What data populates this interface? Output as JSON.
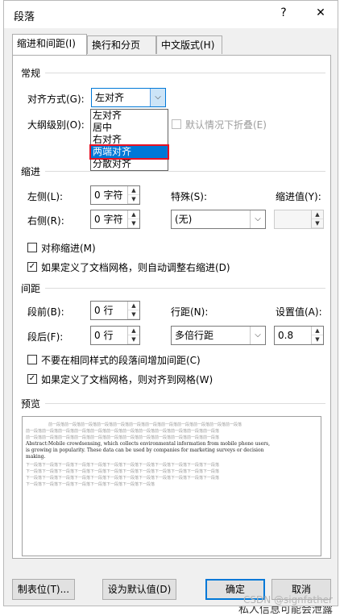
{
  "dialog": {
    "title": "段落",
    "help_button": "?",
    "close_button": "✕"
  },
  "tabs": [
    {
      "label": "缩进和间距(I)"
    },
    {
      "label": "换行和分页(P)"
    },
    {
      "label": "中文版式(H)"
    }
  ],
  "general": {
    "header": "常规",
    "alignment_label": "对齐方式(G):",
    "alignment_value": "左对齐",
    "alignment_options": [
      "左对齐",
      "居中",
      "右对齐",
      "两端对齐",
      "分散对齐"
    ],
    "outline_label": "大纲级别(O):",
    "collapse_label": "默认情况下折叠(E)"
  },
  "indent": {
    "header": "缩进",
    "left_label": "左侧(L):",
    "left_value": "0 字符",
    "right_label": "右侧(R):",
    "right_value": "0 字符",
    "special_label": "特殊(S):",
    "special_value": "(无)",
    "by_label": "缩进值(Y):",
    "mirror_label": "对称缩进(M)",
    "auto_adjust_label": "如果定义了文档网格，则自动调整右缩进(D)"
  },
  "spacing": {
    "header": "间距",
    "before_label": "段前(B):",
    "before_value": "0 行",
    "after_label": "段后(F):",
    "after_value": "0 行",
    "line_spacing_label": "行距(N):",
    "line_spacing_value": "多倍行距",
    "at_label": "设置值(A):",
    "at_value": "0.8",
    "no_space_label": "不要在相同样式的段落间增加间距(C)",
    "snap_grid_label": "如果定义了文档网格，则对齐到网格(W)"
  },
  "preview": {
    "header": "预览",
    "prev_line": "前一段落前一段落前一段落前一段落前一段落前一段落前一段落前一段落前一段落前一段落前一段落前一段落",
    "sample_line1": "Abstract:Mobile crowdsensing, which collects environmental information from mobile phone users,",
    "sample_line2": "is growing in popularity.  These data can be used by companies for marketing surveys or decision",
    "sample_line3": "making.",
    "next_line": "下一段落下一段落下一段落下一段落下一段落下一段落下一段落下一段落下一段落下一段落下一段落下一段落"
  },
  "buttons": {
    "tabs_button": "制表位(T)...",
    "default_button": "设为默认值(D)",
    "ok_button": "确定",
    "cancel_button": "取消"
  },
  "watermark": "CSDN @signfather",
  "background_text": "私人信息可能会泄露"
}
